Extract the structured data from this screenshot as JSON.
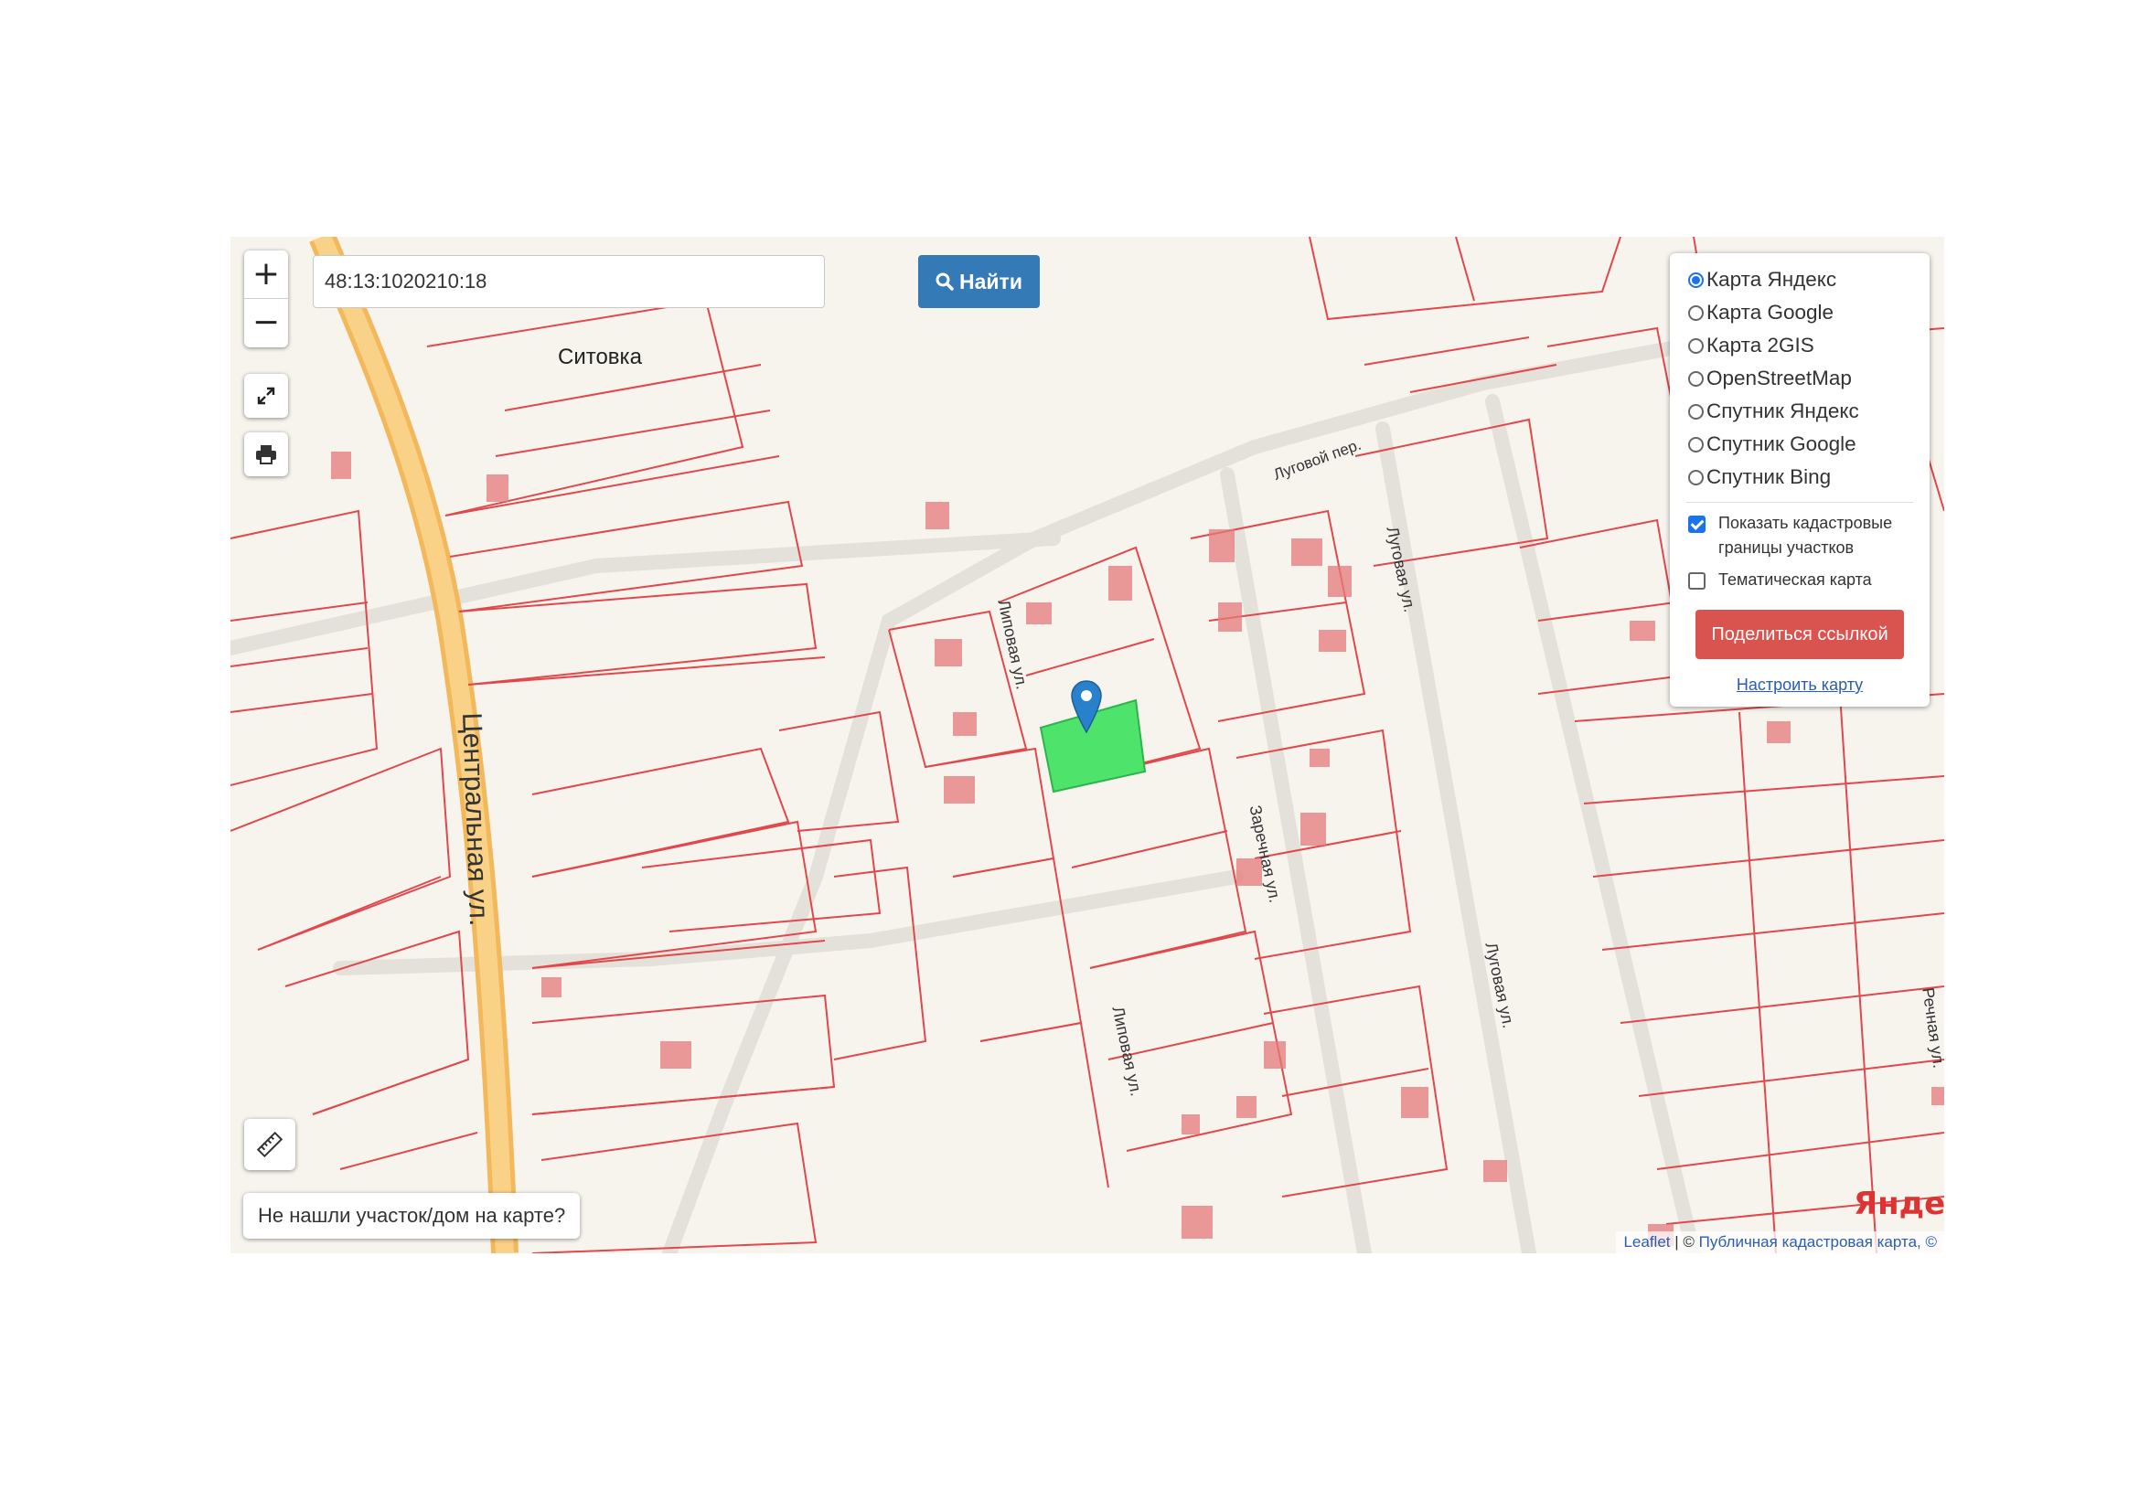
{
  "search": {
    "value": "48:13:1020210:18",
    "button_label": "Найти"
  },
  "zoom": {
    "in_label": "+",
    "out_label": "−"
  },
  "layers": {
    "options": [
      "Карта Яндекс",
      "Карта Google",
      "Карта 2GIS",
      "OpenStreetMap",
      "Спутник Яндекс",
      "Спутник Google",
      "Спутник Bing"
    ],
    "selected": "Карта Яндекс",
    "cadastral_label_1": "Показать кадастровые",
    "cadastral_label_2": "границы участков",
    "cadastral_checked": true,
    "thematic_label": "Тематическая карта",
    "thematic_checked": false,
    "share_label": "Поделиться ссылкой",
    "configure_label": "Настроить карту"
  },
  "not_found_label": "Не нашли участок/дом на карте?",
  "attribution": {
    "leaflet": "Leaflet",
    "sep": " | © ",
    "source": "Публичная кадастровая карта, ©"
  },
  "yandex_logo": "Яндекс",
  "places": {
    "village": "Ситовка",
    "streets": [
      "Центральная ул.",
      "Липовая ул.",
      "Липовая ул.",
      "Заречная ул.",
      "Луговой пер.",
      "Луговая ул.",
      "Луговая ул.",
      "Речная ул."
    ]
  },
  "colors": {
    "parcel": "#e0484c",
    "road": "#f5c56e",
    "selected_parcel": "#4ee36b",
    "marker": "#2a81cb",
    "building": "#e67a7a"
  },
  "icons": [
    "zoom-in-icon",
    "zoom-out-icon",
    "fullscreen-icon",
    "print-icon",
    "search-icon",
    "ruler-icon",
    "map-marker-icon"
  ]
}
